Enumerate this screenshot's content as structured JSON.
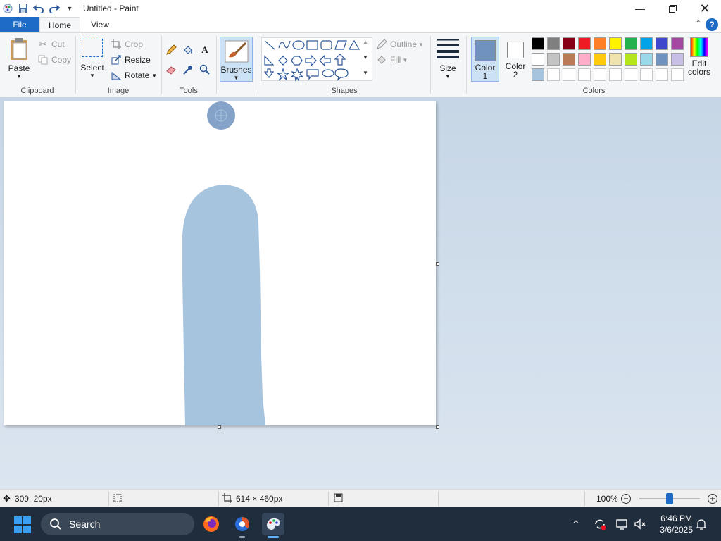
{
  "titlebar": {
    "title": "Untitled - Paint",
    "icons": [
      "paint-app-icon",
      "save-icon",
      "undo-icon",
      "redo-icon",
      "customize-dropdown-icon"
    ]
  },
  "tabs": {
    "file": "File",
    "home": "Home",
    "view": "View"
  },
  "help_label": "?",
  "ribbon": {
    "clipboard": {
      "label": "Clipboard",
      "paste": "Paste",
      "cut": "Cut",
      "copy": "Copy"
    },
    "image": {
      "label": "Image",
      "select": "Select",
      "crop": "Crop",
      "resize": "Resize",
      "rotate": "Rotate"
    },
    "tools": {
      "label": "Tools"
    },
    "brushes": {
      "label": "Brushes"
    },
    "shapes": {
      "label": "Shapes",
      "outline": "Outline",
      "fill": "Fill"
    },
    "size": {
      "label": "Size"
    },
    "colors": {
      "label": "Colors",
      "color1": "Color 1",
      "color2": "Color 2",
      "color1_value": "#7092be",
      "color2_value": "#ffffff",
      "edit_colors": "Edit colors",
      "palette_row1": [
        "#000000",
        "#7f7f7f",
        "#880015",
        "#ed1c24",
        "#ff7f27",
        "#fff200",
        "#22b14c",
        "#00a2e8",
        "#3f48cc",
        "#a349a4"
      ],
      "palette_row2": [
        "#ffffff",
        "#c3c3c3",
        "#b97a57",
        "#ffaec9",
        "#ffc90e",
        "#efe4b0",
        "#b5e61d",
        "#99d9ea",
        "#7092be",
        "#c8bfe7"
      ],
      "palette_row3": [
        "#a7c4de",
        "#ffffff",
        "#ffffff",
        "#ffffff",
        "#ffffff",
        "#ffffff",
        "#ffffff",
        "#ffffff",
        "#ffffff",
        "#ffffff"
      ]
    }
  },
  "canvas": {
    "stroke_color": "#a7c4de",
    "cursor_color": "#7092be"
  },
  "statusbar": {
    "cursor_pos": "309, 20px",
    "canvas_size": "614 × 460px",
    "zoom": "100%",
    "zoom_fraction": 0.5
  },
  "taskbar": {
    "search": "Search",
    "time": "6:46 PM",
    "date": "3/6/2025"
  }
}
